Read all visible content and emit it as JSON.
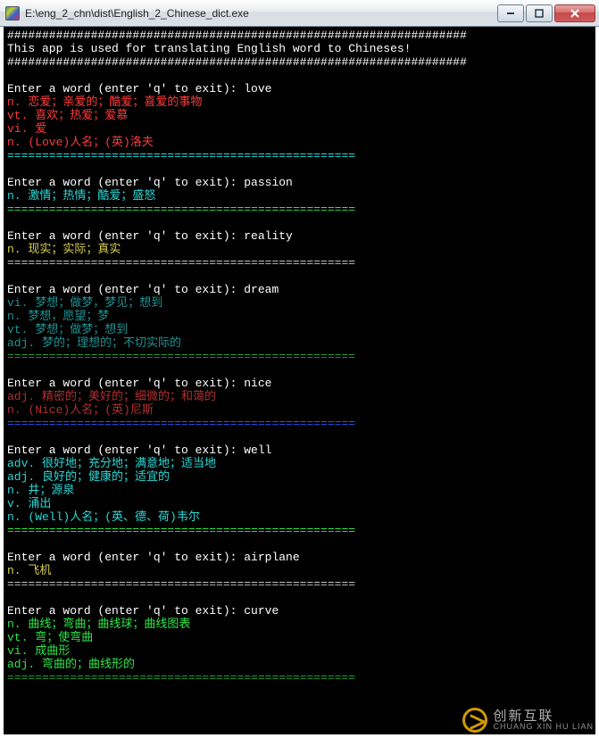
{
  "window": {
    "title": "E:\\eng_2_chn\\dist\\English_2_Chinese_dict.exe"
  },
  "banner": {
    "hash": "##################################################################",
    "text": "This app is used for translating English word to Chineses!"
  },
  "prompt_label": "Enter a word (enter 'q' to exit): ",
  "separator": "==================================================",
  "entries": [
    {
      "word": "love",
      "defs": [
        {
          "cls": "c-red",
          "text": "n. 恋爱；亲爱的；酷爱；喜爱的事物"
        },
        {
          "cls": "c-red",
          "text": "vt. 喜欢；热爱；爱慕"
        },
        {
          "cls": "c-red",
          "text": "vi. 爱"
        },
        {
          "cls": "c-red",
          "text": "n. (Love)人名；(英)洛夫"
        }
      ],
      "sep_cls": "c-cyan"
    },
    {
      "word": "passion",
      "defs": [
        {
          "cls": "c-cyan",
          "text": "n. 激情；热情；酷爱；盛怒"
        }
      ],
      "sep_cls": "c-green"
    },
    {
      "word": "reality",
      "defs": [
        {
          "cls": "c-yellow",
          "text": "n. 现实；实际；真实"
        }
      ],
      "sep_cls": "c-grey"
    },
    {
      "word": "dream",
      "defs": [
        {
          "cls": "c-dcyan",
          "text": "vi. 梦想；做梦，梦见；想到"
        },
        {
          "cls": "c-dcyan",
          "text": "n. 梦想，愿望；梦"
        },
        {
          "cls": "c-dcyan",
          "text": "vt. 梦想；做梦；想到"
        },
        {
          "cls": "c-dcyan",
          "text": "adj. 梦的；理想的；不切实际的"
        }
      ],
      "sep_cls": "c-dgreen"
    },
    {
      "word": "nice",
      "defs": [
        {
          "cls": "c-dred",
          "text": "adj. 精密的；美好的；细微的；和蔼的"
        },
        {
          "cls": "c-dred",
          "text": "n. (Nice)人名；(英)尼斯"
        }
      ],
      "sep_cls": "c-blue"
    },
    {
      "word": "well",
      "defs": [
        {
          "cls": "c-cyan",
          "text": "adv. 很好地；充分地；满意地；适当地"
        },
        {
          "cls": "c-cyan",
          "text": "adj. 良好的；健康的；适宜的"
        },
        {
          "cls": "c-cyan",
          "text": "n. 井；源泉"
        },
        {
          "cls": "c-cyan",
          "text": "v. 涌出"
        },
        {
          "cls": "c-cyan",
          "text": "n. (Well)人名；(英、德、荷)韦尔"
        }
      ],
      "sep_cls": "c-green"
    },
    {
      "word": "airplane",
      "defs": [
        {
          "cls": "c-yellow",
          "text": "n. 飞机"
        }
      ],
      "sep_cls": "c-grey"
    },
    {
      "word": "curve",
      "defs": [
        {
          "cls": "c-green",
          "text": "n. 曲线；弯曲；曲线球；曲线图表"
        },
        {
          "cls": "c-green",
          "text": "vt. 弯；使弯曲"
        },
        {
          "cls": "c-green",
          "text": "vi. 成曲形"
        },
        {
          "cls": "c-green",
          "text": "adj. 弯曲的；曲线形的"
        }
      ],
      "sep_cls": "c-dgreen"
    }
  ],
  "watermark": {
    "big": "创新互联",
    "small": "CHUANG XIN HU LIAN"
  }
}
